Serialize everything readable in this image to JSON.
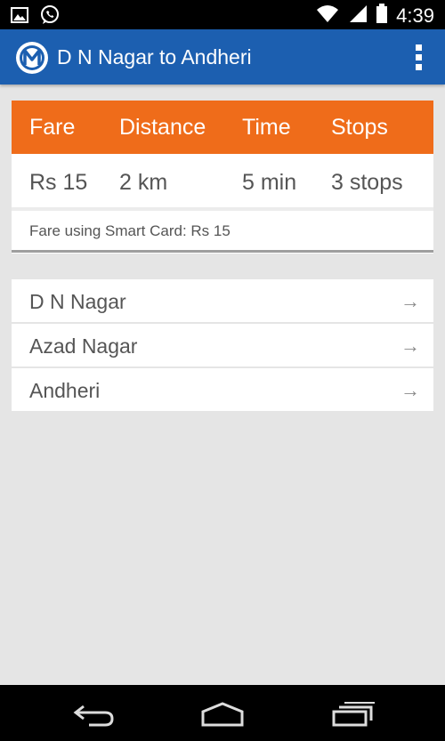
{
  "status_bar": {
    "time": "4:39",
    "left_icons": [
      "gallery-icon",
      "whatsapp-icon"
    ],
    "right_icons": [
      "wifi-icon",
      "cellular-signal-icon",
      "battery-icon"
    ]
  },
  "action_bar": {
    "title": "D N Nagar to Andheri",
    "logo": "metro-logo",
    "menu_icon": "overflow-menu-icon"
  },
  "summary": {
    "headers": [
      "Fare",
      "Distance",
      "Time",
      "Stops"
    ],
    "values": [
      "Rs 15",
      "2 km",
      "5 min",
      "3 stops"
    ],
    "smart_card_text": "Fare using Smart Card: Rs 15"
  },
  "stops": [
    {
      "name": "D N Nagar",
      "arrow": "→"
    },
    {
      "name": "Azad Nagar",
      "arrow": "→"
    },
    {
      "name": "Andheri",
      "arrow": "→"
    }
  ],
  "nav_bar": {
    "buttons": [
      "back-icon",
      "home-icon",
      "recent-apps-icon"
    ]
  },
  "colors": {
    "action_bar": "#1c5fb0",
    "summary_header": "#ef6c1a",
    "background": "#e5e5e5"
  }
}
